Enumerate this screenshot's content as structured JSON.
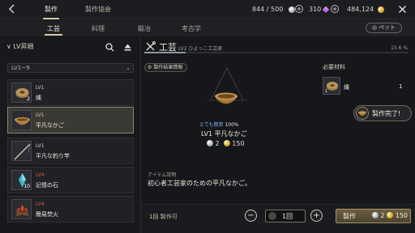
{
  "top_tabs": [
    "製作",
    "製作協会"
  ],
  "resources": {
    "energy": "844 / 500",
    "gems": "310",
    "gold": "484,124"
  },
  "sub_tabs": [
    "工芸",
    "料理",
    "鍛冶",
    "考古学"
  ],
  "pet_label": "ペット",
  "left": {
    "header": "LV昇順",
    "filter": "LV1~9",
    "items": [
      {
        "lv": "LV1",
        "name": "縄",
        "count": "2",
        "selected": false,
        "lv_color": "normal"
      },
      {
        "lv": "LV1",
        "name": "平凡なかご",
        "count": "",
        "selected": true,
        "lv_color": "normal"
      },
      {
        "lv": "LV1",
        "name": "平凡な釣り竿",
        "count": "",
        "selected": false,
        "lv_color": "normal"
      },
      {
        "lv": "LV4",
        "name": "記憶の石",
        "count": "10",
        "selected": false,
        "lv_color": "red"
      },
      {
        "lv": "LV4",
        "name": "簡易焚火",
        "count": "",
        "selected": false,
        "lv_color": "red"
      }
    ]
  },
  "detail": {
    "title": "工芸",
    "subtitle": "LV2 ひよっこ工芸家",
    "progress_percent": 15.6,
    "progress_label": "15.6 %",
    "craft_info_button": "製作結果情報",
    "chance_label": "とても簡単",
    "chance_value": "100%",
    "item_name": "LV1 平凡なかご",
    "cost_silver": "2",
    "cost_gold": "150",
    "desc_label": "アイテム説明",
    "desc": "初心者工芸家のための平凡なかご。",
    "required_title": "必要材料",
    "required": [
      {
        "name": "縄",
        "qty": "1",
        "count": "1"
      }
    ],
    "done_label": "製作完了!"
  },
  "bottom": {
    "count": "1",
    "count_suffix": "回 製作可",
    "qty": "1回",
    "minus": "−",
    "plus": "+",
    "craft_label": "製作",
    "craft_silver": "2",
    "craft_gold": "150"
  },
  "colors": {
    "accent": "#d6c9a3",
    "red_level": "#d2594a",
    "chance_blue": "#7fb2e6"
  }
}
